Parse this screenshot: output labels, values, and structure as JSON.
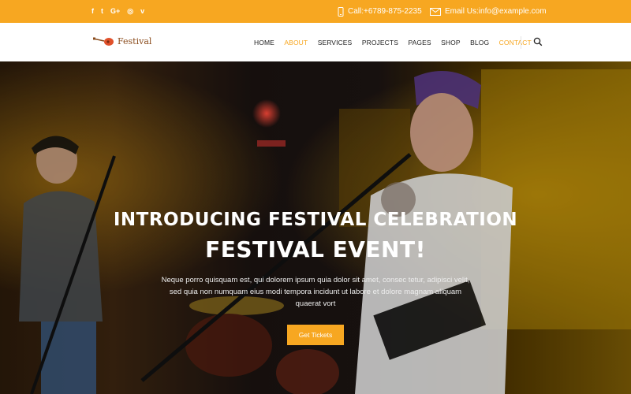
{
  "topbar": {
    "social": [
      {
        "icon": "facebook-icon",
        "glyph": "f"
      },
      {
        "icon": "twitter-icon",
        "glyph": "t"
      },
      {
        "icon": "google-plus-icon",
        "glyph": "G+"
      },
      {
        "icon": "dribbble-icon",
        "glyph": "◎"
      },
      {
        "icon": "vimeo-icon",
        "glyph": "v"
      }
    ],
    "phone": "Call:+6789-875-2235",
    "email": "Email Us:info@example.com",
    "bg_color": "#f7a721"
  },
  "nav": {
    "logo_text": "Festival",
    "items": [
      {
        "label": "HOME",
        "state": "normal"
      },
      {
        "label": "ABOUT",
        "state": "active"
      },
      {
        "label": "SERVICES",
        "state": "normal"
      },
      {
        "label": "PROJECTS",
        "state": "normal"
      },
      {
        "label": "PAGES",
        "state": "normal"
      },
      {
        "label": "SHOP",
        "state": "normal"
      },
      {
        "label": "BLOG",
        "state": "normal"
      },
      {
        "label": "CONTACT",
        "state": "highlight"
      }
    ],
    "search_icon": "search-icon"
  },
  "hero": {
    "title": "INTRODUCING FESTIVAL CELEBRATION",
    "subtitle": "FESTIVAL EVENT!",
    "text": "Neque porro quisquam est, qui dolorem ipsum quia dolor sit amet, consec tetur, adipisci velit, sed quia non numquam eius modi tempora incidunt ut labore et dolore magnam aliquam quaerat vort",
    "cta_label": "Get Tickets",
    "accent_color": "#f7a721"
  }
}
